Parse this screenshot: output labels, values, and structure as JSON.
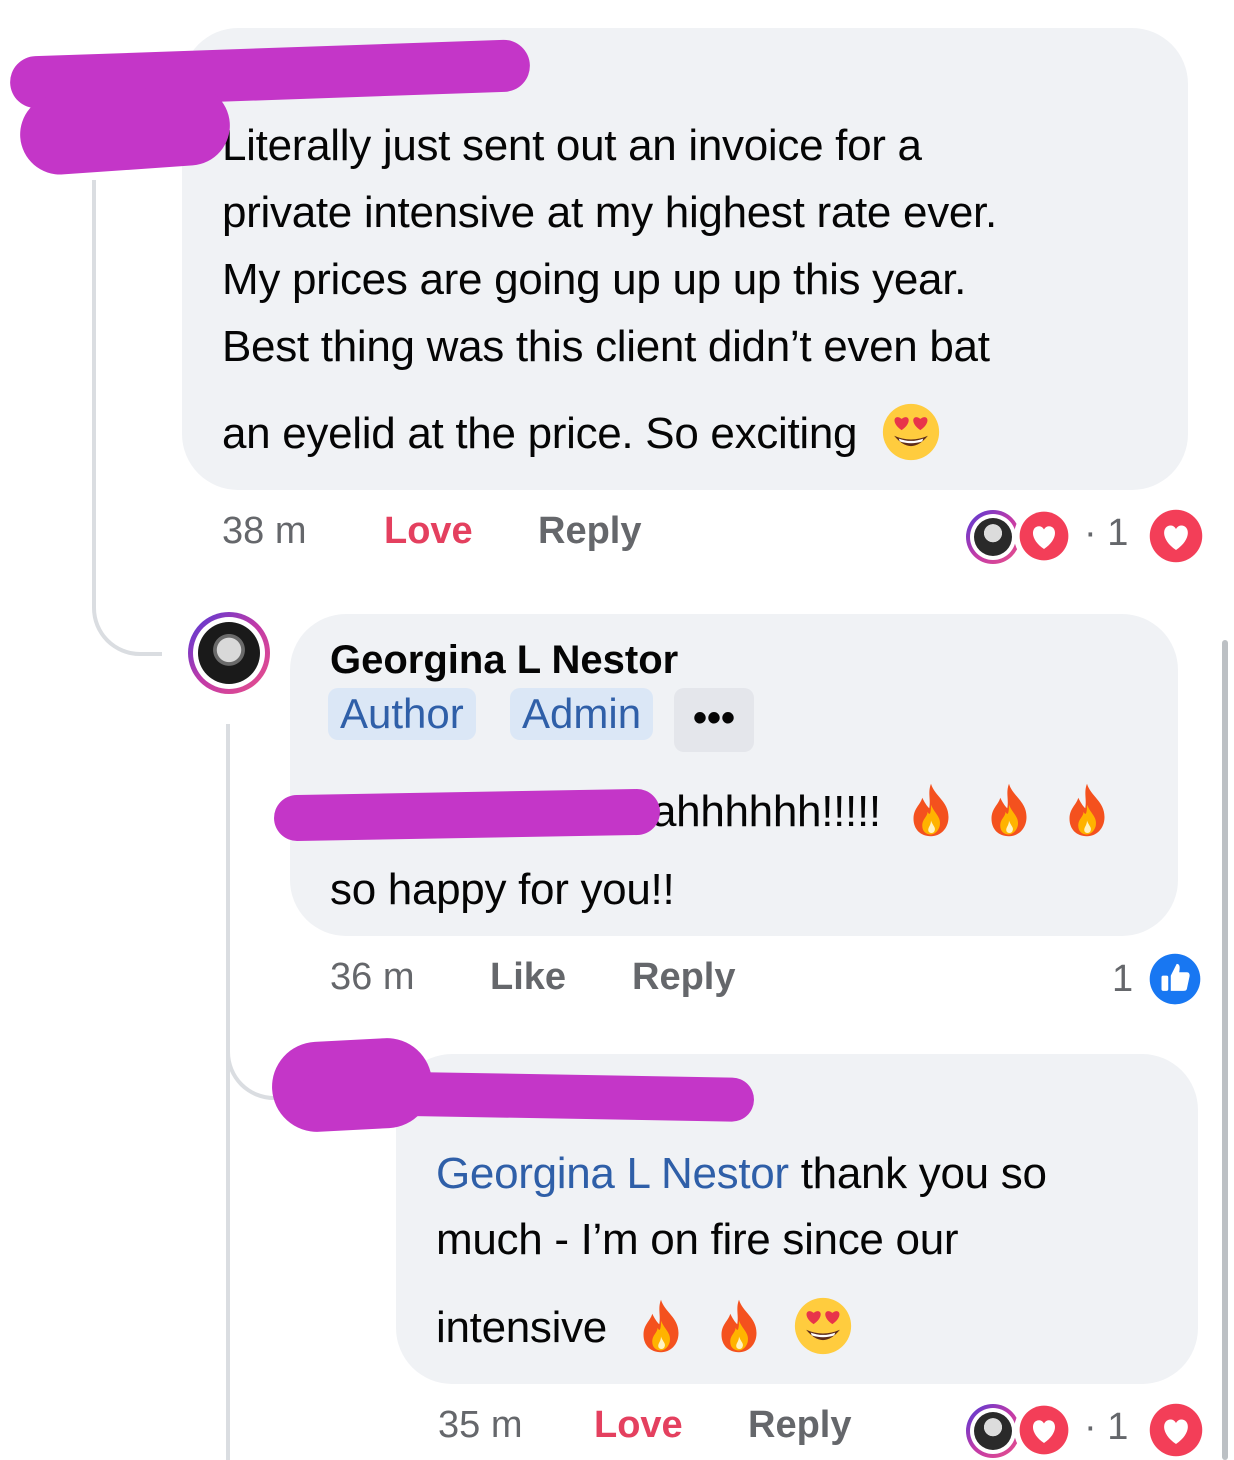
{
  "comment1": {
    "text": "Literally just sent out an invoice for a private intensive at my highest rate ever. My prices are going up up up this year. Best thing was this client didn’t even bat an eyelid at the price. So exciting",
    "line1": "Literally just sent out an invoice for a",
    "line2": "private intensive at my highest rate ever.",
    "line3": "My prices are going up up up this year.",
    "line4": "Best thing was this client didn’t even bat",
    "line5": "an eyelid at the price. So exciting",
    "time": "38 m",
    "love_label": "Love",
    "reply_label": "Reply",
    "reaction_count": "1"
  },
  "comment2": {
    "author": "Georgina L Nestor",
    "badge_author": "Author",
    "badge_admin": "Admin",
    "more_label": "•••",
    "text_line1": "ahhhhhh!!!!!",
    "text_line2": "so happy for you!!",
    "time": "36 m",
    "like_label": "Like",
    "reply_label": "Reply",
    "reaction_count": "1"
  },
  "comment3": {
    "mention": "Georgina L Nestor",
    "line1_rest": " thank you so",
    "line2": "much - I’m on fire since our",
    "line3": "intensive",
    "time": "35 m",
    "love_label": "Love",
    "reply_label": "Reply",
    "reaction_count": "1"
  },
  "icons": {
    "heart_eyes": "heart-eyes-emoji",
    "fire": "fire-emoji",
    "love_reaction": "heart-reaction-icon",
    "like_reaction": "thumbs-up-reaction-icon"
  },
  "colors": {
    "bubble": "#f0f2f5",
    "love": "#e4405f",
    "link": "#2f5fa8",
    "like_blue": "#1877f2",
    "redaction": "#c436c8"
  }
}
